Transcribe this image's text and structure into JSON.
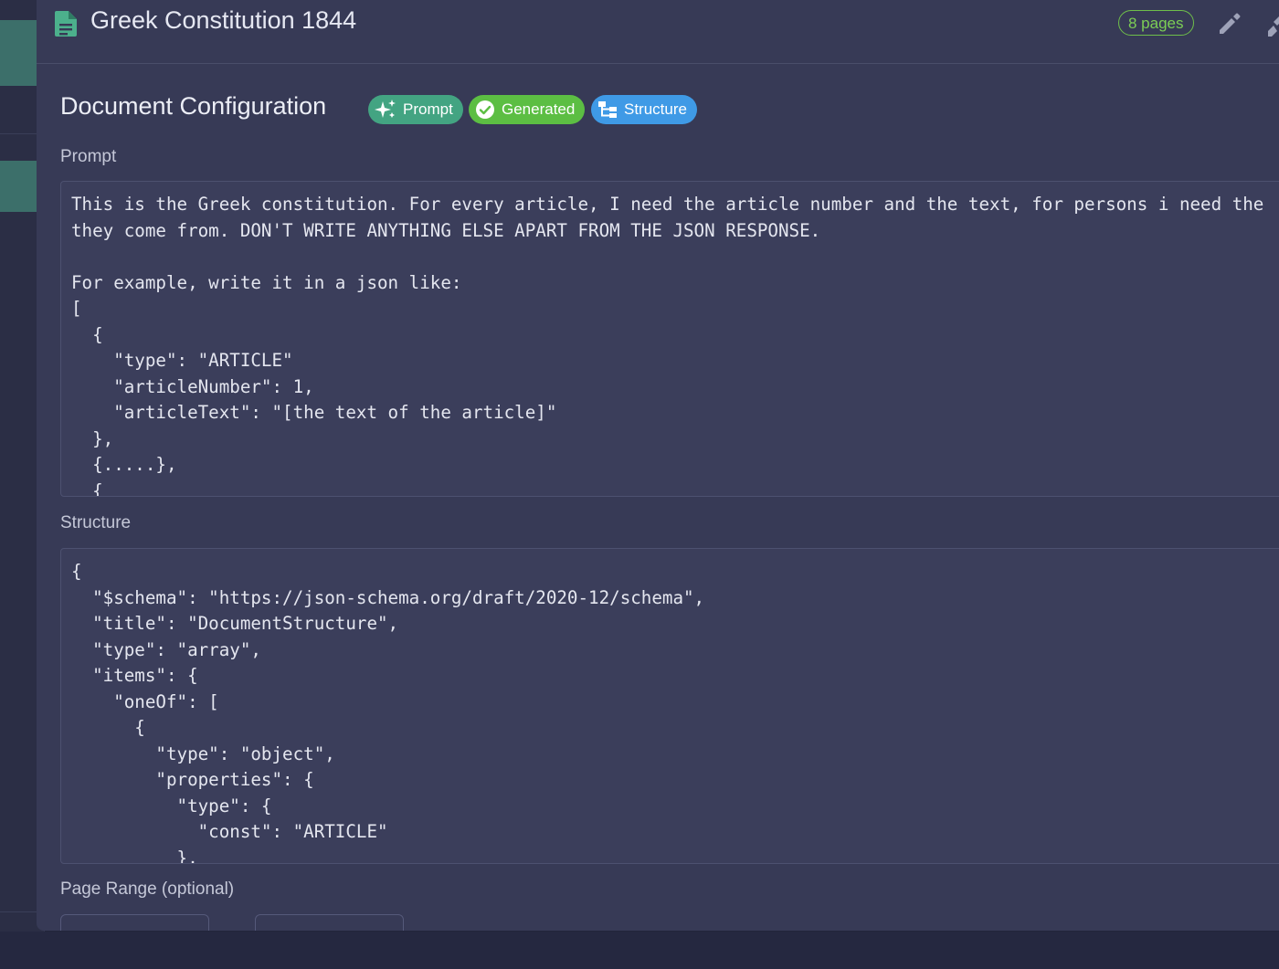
{
  "header": {
    "title": "Greek Constitution 1844",
    "pages_badge": "8 pages",
    "doc_icon": "document-icon",
    "edit_icon": "pencil-icon",
    "extra_icon": "wrench-icon"
  },
  "config": {
    "title": "Document Configuration",
    "badges": [
      {
        "label": "Prompt",
        "icon": "sparkles-icon",
        "color": "#43a482"
      },
      {
        "label": "Generated",
        "icon": "check-circle-icon",
        "color": "#5cbe43"
      },
      {
        "label": "Structure",
        "icon": "hierarchy-icon",
        "color": "#3f9ae6"
      }
    ]
  },
  "prompt": {
    "label": "Prompt",
    "text": "This is the Greek constitution. For every article, I need the article number and the text, for persons i need the\nthey come from. DON'T WRITE ANYTHING ELSE APART FROM THE JSON RESPONSE.\n\nFor example, write it in a json like:\n[\n  {\n    \"type\": \"ARTICLE\"\n    \"articleNumber\": 1,\n    \"articleText\": \"[the text of the article]\"\n  },\n  {.....},\n  {"
  },
  "structure": {
    "label": "Structure",
    "text": "{\n  \"$schema\": \"https://json-schema.org/draft/2020-12/schema\",\n  \"title\": \"DocumentStructure\",\n  \"type\": \"array\",\n  \"items\": {\n    \"oneOf\": [\n      {\n        \"type\": \"object\",\n        \"properties\": {\n          \"type\": {\n            \"const\": \"ARTICLE\"\n          },"
  },
  "page_range": {
    "label": "Page Range (optional)"
  },
  "colors": {
    "panel": "#373a56",
    "accent_green": "#43a482",
    "badge_green": "#5cbe43",
    "badge_blue": "#3f9ae6",
    "pages_badge": "#7cce55"
  }
}
